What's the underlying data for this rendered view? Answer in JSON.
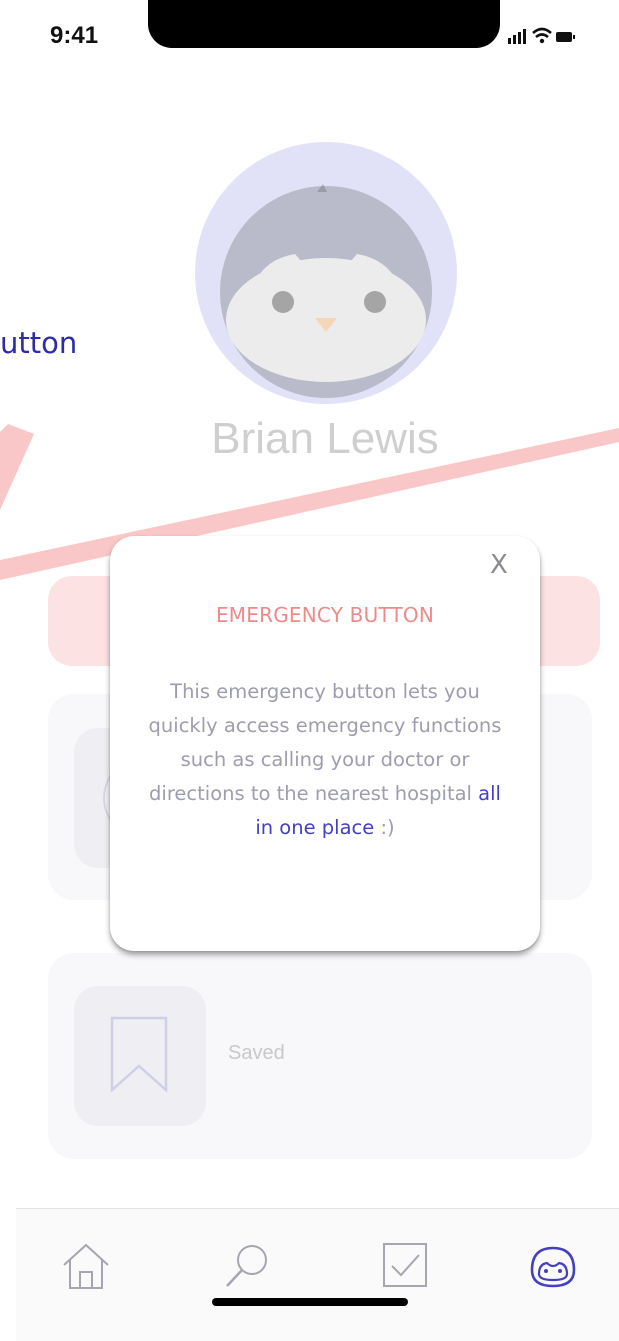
{
  "status_bar": {
    "time": "9:41"
  },
  "profile": {
    "name": "Brian Lewis"
  },
  "tour": {
    "label": "utton"
  },
  "cards": {
    "saved_label": "Saved"
  },
  "popup": {
    "close": "X",
    "title": "EMERGENCY BUTTON",
    "body_text": "This emergency button lets you quickly access emergency functions such as calling your doctor or directions to the nearest hospital ",
    "body_highlight": "all in one place",
    "body_end": " :)"
  },
  "tabbar": {
    "items": [
      {
        "icon": "home-icon"
      },
      {
        "icon": "search-icon"
      },
      {
        "icon": "checkbox-icon"
      },
      {
        "icon": "penguin-profile-icon",
        "active": true
      }
    ]
  },
  "colors": {
    "accent": "#4441c0",
    "emergency": "#ef8a8a",
    "arrow": "#f9c7c7"
  }
}
